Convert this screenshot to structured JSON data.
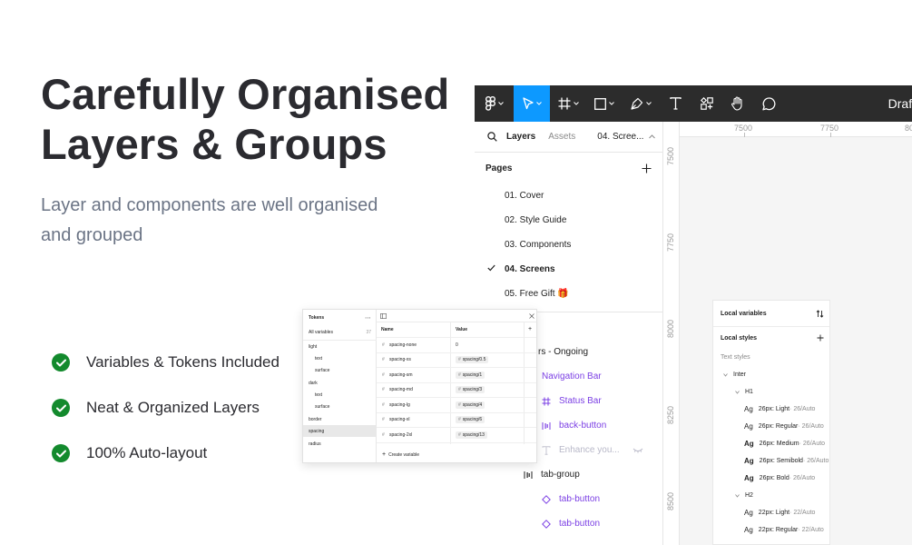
{
  "hero": {
    "title_line1": "Carefully Organised",
    "title_line2": "Layers & Groups",
    "subtitle_line1": "Layer and components are well organised",
    "subtitle_line2": "and grouped"
  },
  "features": [
    {
      "text": "Variables & Tokens Included"
    },
    {
      "text": "Neat & Organized Layers"
    },
    {
      "text": "100% Auto-layout"
    }
  ],
  "colors": {
    "check_green": "#138a2d",
    "toolbar_bg": "#2c2c2c",
    "accent_blue": "#0d99ff",
    "component_purple": "#7b3fe4"
  },
  "figma": {
    "toolbar": {
      "tools": [
        "figma-menu-icon",
        "move-tool-icon",
        "frame-tool-icon",
        "rectangle-tool-icon",
        "pen-tool-icon",
        "text-tool-icon",
        "resources-icon",
        "hand-tool-icon",
        "comment-icon"
      ],
      "draft_label": "Draft"
    },
    "ruler_top": [
      "7500",
      "7750",
      "80"
    ],
    "ruler_left": [
      "7500",
      "7750",
      "8000",
      "8250",
      "8500"
    ],
    "panel_tabs": {
      "layers": "Layers",
      "assets": "Assets",
      "page": "04. Scree..."
    },
    "pages_title": "Pages",
    "pages": [
      {
        "label": "01. Cover"
      },
      {
        "label": "02. Style Guide"
      },
      {
        "label": "03. Components"
      },
      {
        "label": "04. Screens",
        "current": true
      },
      {
        "label": "05. Free Gift 🎁"
      }
    ],
    "layers": [
      {
        "label": "rs - Ongoing"
      },
      {
        "label": "Navigation Bar"
      },
      {
        "label": "Status Bar"
      },
      {
        "label": "back-button"
      },
      {
        "label": "Enhance you..."
      },
      {
        "label": "tab-group"
      },
      {
        "label": "tab-button"
      },
      {
        "label": "tab-button"
      }
    ],
    "variables_panel": {
      "local_variables": "Local variables",
      "local_styles": "Local styles",
      "text_styles": "Text styles",
      "inter": "Inter",
      "h1": "H1",
      "h2": "H2",
      "ag": "Ag",
      "styles": [
        {
          "name": "26px: Light",
          "meta": " · 26/Auto"
        },
        {
          "name": "26px: Regular",
          "meta": " · 26/Auto"
        },
        {
          "name": "26px: Medium",
          "meta": " · 26/Auto"
        },
        {
          "name": "26px: Semibold",
          "meta": " · 26/Auto"
        },
        {
          "name": "26px: Bold",
          "meta": " · 26/Auto"
        },
        {
          "name": "22px: Light",
          "meta": " · 22/Auto"
        },
        {
          "name": "22px: Regular",
          "meta": " · 22/Auto"
        }
      ]
    }
  },
  "tokens": {
    "title": "Tokens",
    "all_variables": "All variables",
    "all_count": "37",
    "groups": [
      "light",
      "text",
      "surface",
      "dark",
      "text",
      "surface",
      "border",
      "spacing",
      "radius"
    ],
    "col_name": "Name",
    "col_value": "Value",
    "rows": [
      {
        "name": "spacing-none",
        "value": "0"
      },
      {
        "name": "spacing-xs",
        "value": "spacing/0.5"
      },
      {
        "name": "spacing-sm",
        "value": "spacing/1"
      },
      {
        "name": "spacing-md",
        "value": "spacing/3"
      },
      {
        "name": "spacing-lg",
        "value": "spacing/4"
      },
      {
        "name": "spacing-xl",
        "value": "spacing/6"
      },
      {
        "name": "spacing-2xl",
        "value": "spacing/13"
      }
    ],
    "create_variable": "Create variable"
  }
}
